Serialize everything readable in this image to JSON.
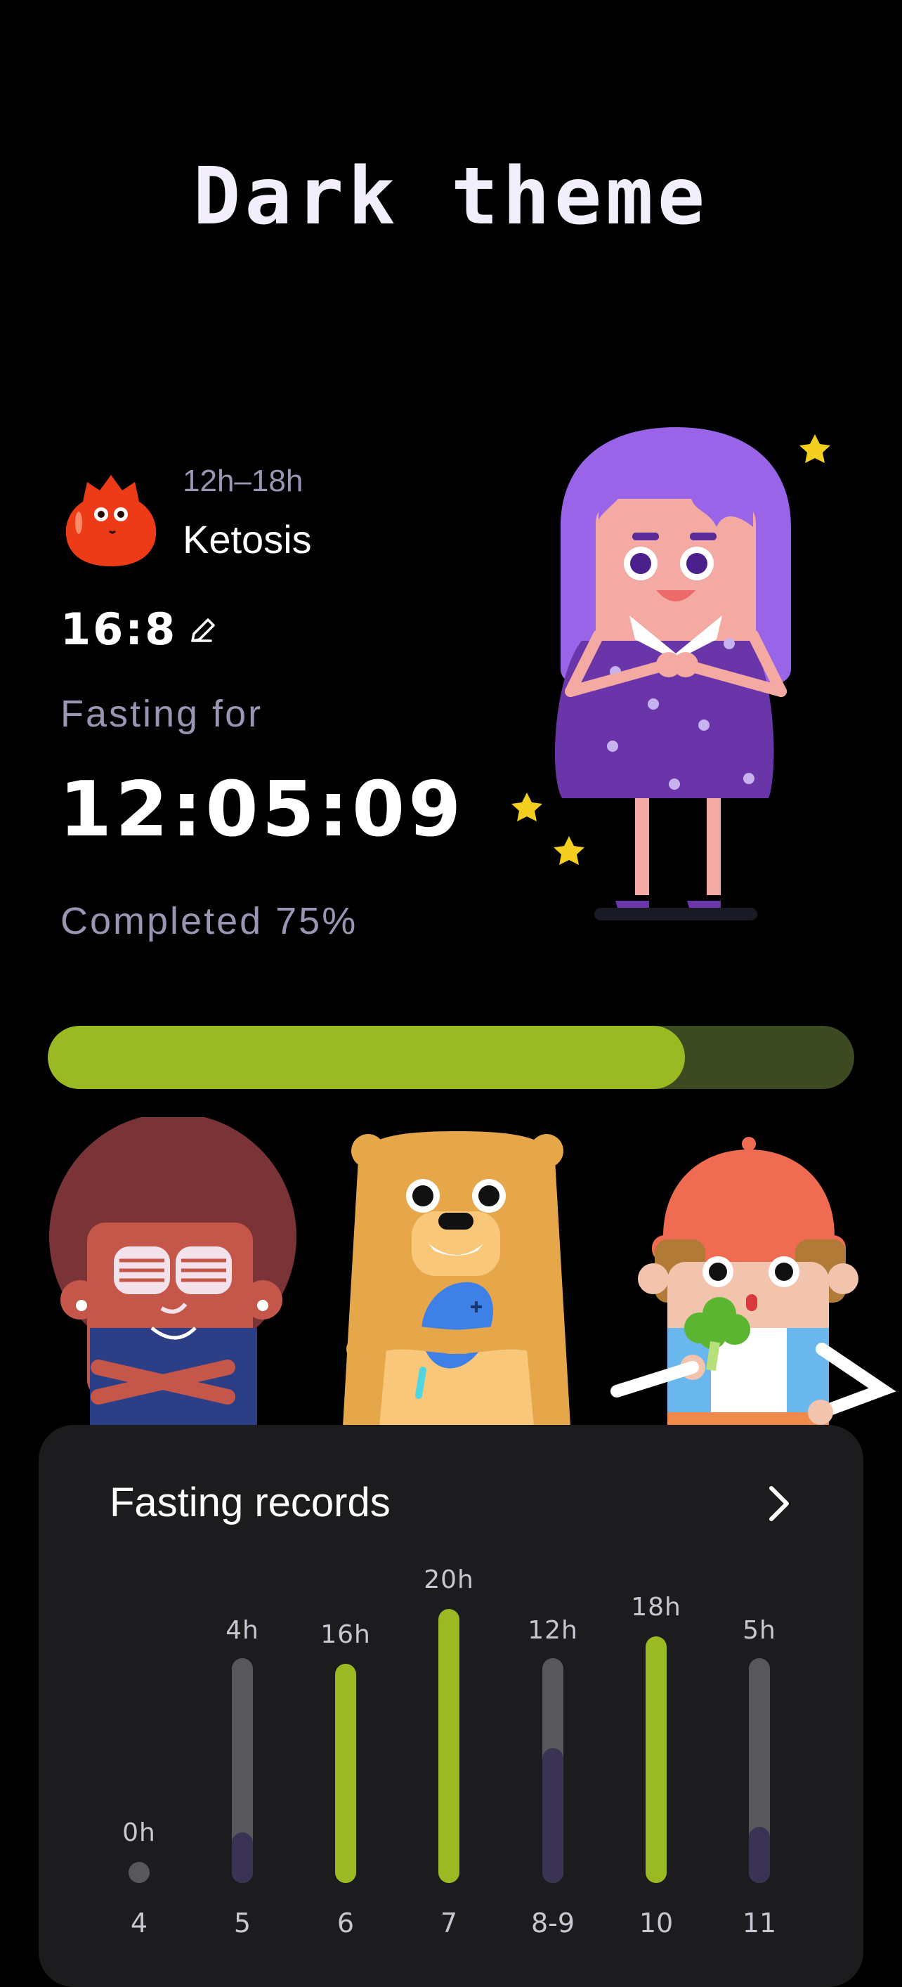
{
  "header": {
    "title": "Dark theme"
  },
  "fasting": {
    "phase_icon": "flame-mascot-icon",
    "phase_range": "12h–18h",
    "phase_name": "Ketosis",
    "plan": "16:8",
    "fasting_label": "Fasting for",
    "elapsed": "12:05:09",
    "completed_text": "Completed 75%",
    "progress_percent": 79
  },
  "records": {
    "title": "Fasting records",
    "arrow_icon": "chevron-right-icon",
    "bars": [
      {
        "label": "0h",
        "day": "4",
        "hours": 0,
        "goal_met": false
      },
      {
        "label": "4h",
        "day": "5",
        "hours": 4,
        "goal_met": false
      },
      {
        "label": "16h",
        "day": "6",
        "hours": 16,
        "goal_met": true
      },
      {
        "label": "20h",
        "day": "7",
        "hours": 20,
        "goal_met": true
      },
      {
        "label": "12h",
        "day": "8-9",
        "hours": 12,
        "goal_met": false
      },
      {
        "label": "18h",
        "day": "10",
        "hours": 18,
        "goal_met": true
      },
      {
        "label": "5h",
        "day": "11",
        "hours": 5,
        "goal_met": false
      }
    ]
  },
  "colors": {
    "background": "#000000",
    "accent_green": "#9bb923",
    "track_green": "#3d4a21",
    "muted_text": "#9b95b4",
    "card": "#1c1c1e",
    "bar_track": "#58585c",
    "bar_partial": "#3a3354"
  }
}
